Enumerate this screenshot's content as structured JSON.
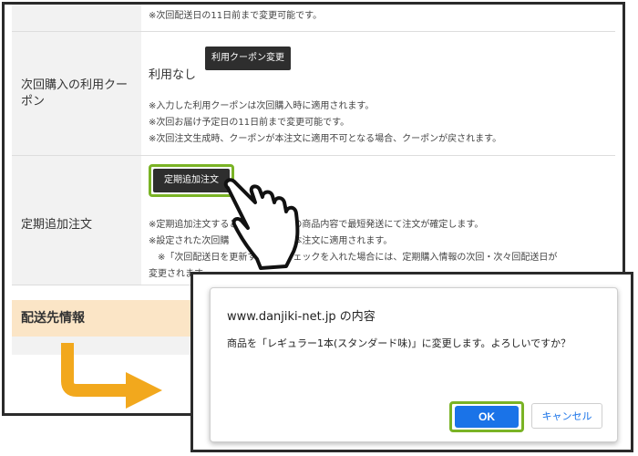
{
  "page": {
    "top_note": "※次回配送日の11日前まで変更可能です。",
    "coupon": {
      "label": "次回購入の利用クーポン",
      "value": "利用なし",
      "change_button": "利用クーポン変更",
      "notes": [
        "※入力した利用クーポンは次回購入時に適用されます。",
        "※次回お届け予定日の11日前まで変更可能です。",
        "※次回注文生成時、クーポンが本注文に適用不可となる場合、クーポンが戻されます。"
      ]
    },
    "additional_order": {
      "label": "定期追加注文",
      "button": "定期追加注文",
      "notes": [
        "※定期追加注文すると　　　　　　の商品内容で最短発送にて注文が確定します。",
        "※設定された次回購　　　　　　　本注文に適用されます。",
        "　※「次回配送日を更新す　　　　ェックを入れた場合には、定期購入情報の次回・次々回配送日が",
        "変更されます"
      ]
    },
    "shipping": {
      "label": "配送先情報"
    }
  },
  "dialog": {
    "origin": "www.danjiki-net.jp の内容",
    "message": "商品を「レギュラー1本(スタンダード味)」に変更します。よろしいですか？",
    "ok_label": "OK",
    "cancel_label": "キャンセル"
  },
  "colors": {
    "highlight": "#7ab325",
    "ok_button": "#1a73e8",
    "arrow": "#f2a81d",
    "shipping_header": "#fbe5c6"
  },
  "icons": {
    "hand": "pointing-hand-icon",
    "arrow": "flow-arrow-icon"
  }
}
